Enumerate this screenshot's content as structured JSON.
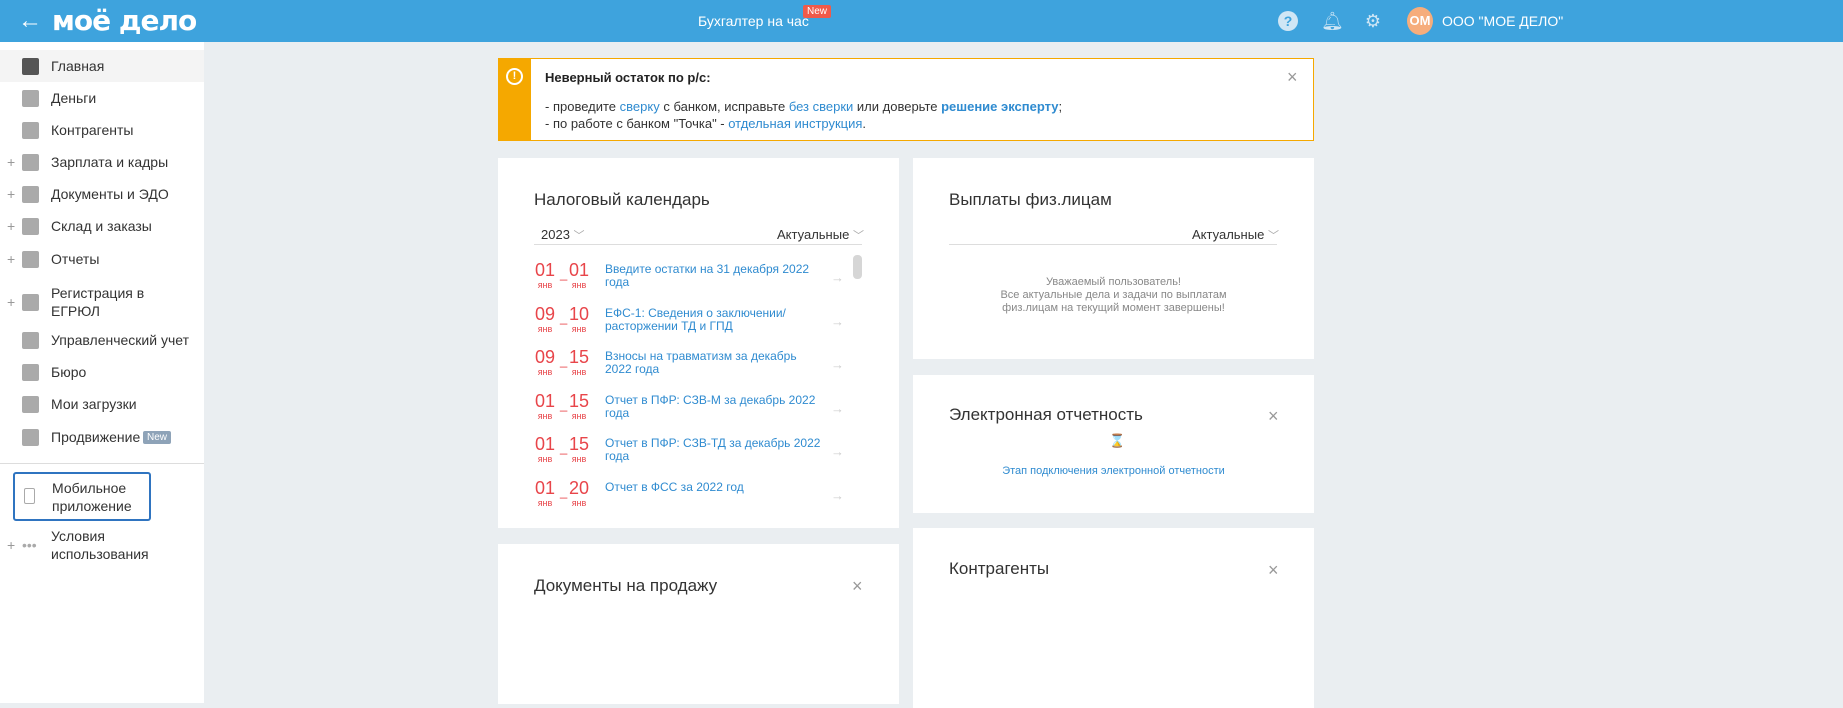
{
  "header": {
    "logo": "моё дело",
    "center_link": "Бухгалтер на час",
    "new_badge": "New",
    "avatar_initials": "ОМ",
    "org_name": "ООО \"МОЕ ДЕЛО\""
  },
  "sidebar": {
    "items": [
      {
        "label": "Главная",
        "expandable": false
      },
      {
        "label": "Деньги",
        "expandable": false
      },
      {
        "label": "Контрагенты",
        "expandable": false
      },
      {
        "label": "Зарплата и кадры",
        "expandable": true
      },
      {
        "label": "Документы и ЭДО",
        "expandable": true
      },
      {
        "label": "Склад и заказы",
        "expandable": true
      },
      {
        "label": "Отчеты",
        "expandable": true
      },
      {
        "label": "Регистрация в ЕГРЮЛ",
        "expandable": true
      },
      {
        "label": "Управленческий учет",
        "expandable": false
      },
      {
        "label": "Бюро",
        "expandable": false
      },
      {
        "label": "Мои загрузки",
        "expandable": false
      },
      {
        "label": "Продвижение",
        "expandable": false,
        "badge": "New"
      }
    ],
    "mobile_app": "Мобильное приложение",
    "terms": "Условия использования"
  },
  "alert": {
    "title": "Неверный остаток по р/с:",
    "l1_a": "- проведите ",
    "l1_link1": "сверку",
    "l1_b": " с банком, исправьте ",
    "l1_link2": "без сверки",
    "l1_c": " или доверьте ",
    "l1_link3": "решение эксперту",
    "l1_d": ";",
    "l2_a": "- по работе с банком \"Точка\" - ",
    "l2_link": "отдельная инструкция",
    "l2_b": "."
  },
  "tax_calendar": {
    "title": "Налоговый календарь",
    "year": "2023",
    "filter": "Актуальные",
    "rows": [
      {
        "from": "01",
        "from_m": "янв",
        "to": "01",
        "to_m": "янв",
        "text": "Введите остатки на 31 декабря 2022 года"
      },
      {
        "from": "09",
        "from_m": "янв",
        "to": "10",
        "to_m": "янв",
        "text": "ЕФС-1: Сведения о заключении/ расторжении ТД и ГПД"
      },
      {
        "from": "09",
        "from_m": "янв",
        "to": "15",
        "to_m": "янв",
        "text": "Взносы на травматизм за декабрь 2022 года"
      },
      {
        "from": "01",
        "from_m": "янв",
        "to": "15",
        "to_m": "янв",
        "text": "Отчет в ПФР: СЗВ-М за декабрь 2022 года"
      },
      {
        "from": "01",
        "from_m": "янв",
        "to": "15",
        "to_m": "янв",
        "text": "Отчет в ПФР: СЗВ-ТД за декабрь 2022 года"
      },
      {
        "from": "01",
        "from_m": "янв",
        "to": "20",
        "to_m": "янв",
        "text": "Отчет в ФСС за 2022 год"
      }
    ]
  },
  "payouts": {
    "title": "Выплаты физ.лицам",
    "filter": "Актуальные",
    "l1": "Уважаемый пользователь!",
    "l2": "Все актуальные дела и задачи по выплатам",
    "l3": "физ.лицам на текущий момент завершены!"
  },
  "e_reporting": {
    "title": "Электронная отчетность",
    "link": "Этап подключения электронной отчетности"
  },
  "docs_sale": {
    "title": "Документы на продажу"
  },
  "contractors": {
    "title": "Контрагенты"
  }
}
